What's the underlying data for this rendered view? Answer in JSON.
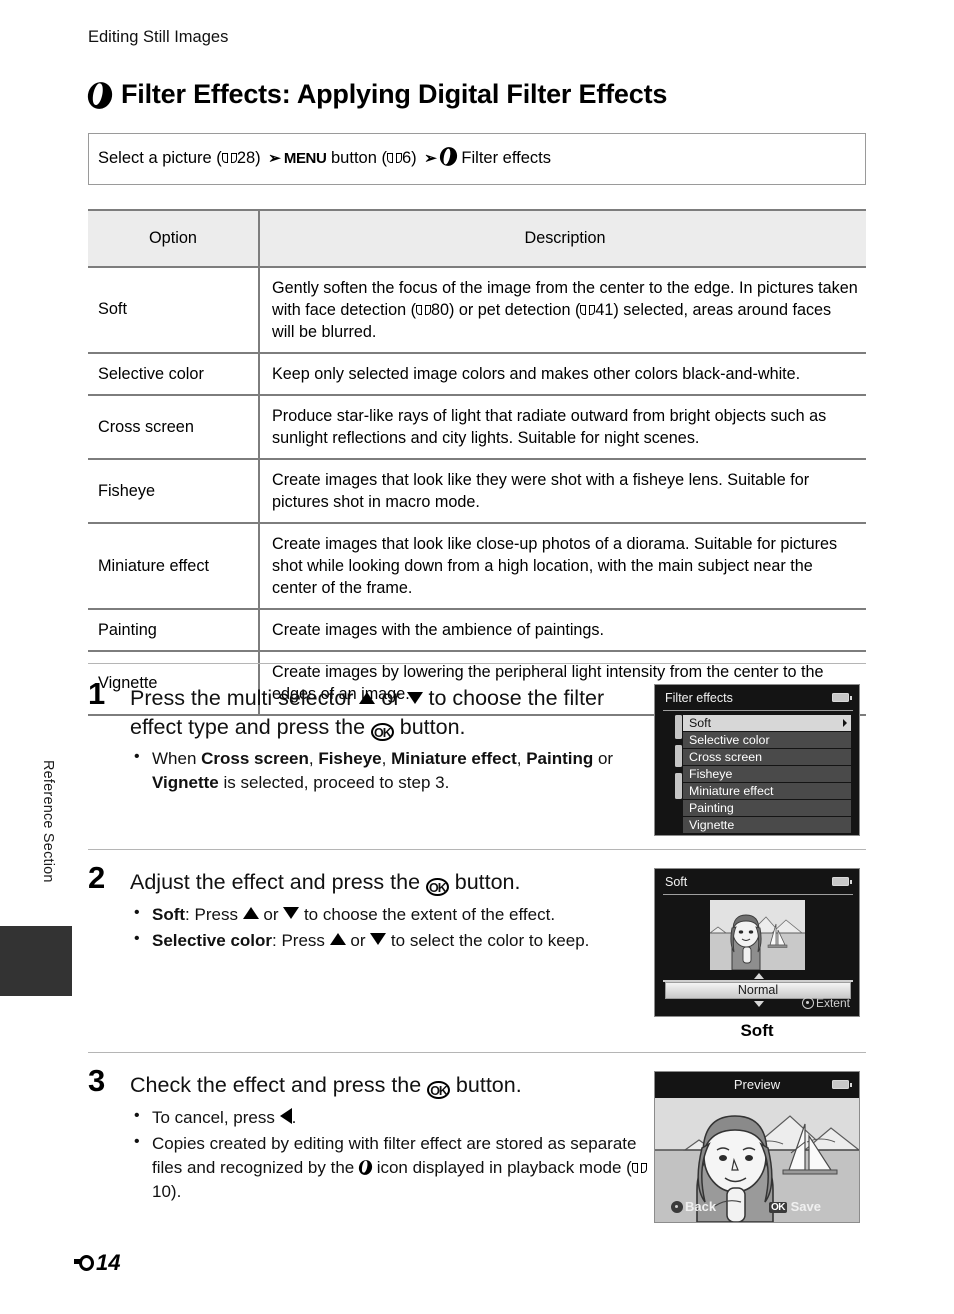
{
  "running_head": "Editing Still Images",
  "side_tab": {
    "label": "Reference Section"
  },
  "page_title": "Filter Effects: Applying Digital Filter Effects",
  "breadcrumb": {
    "part1": "Select a picture (",
    "ref1": "28",
    "part2": ") ",
    "menu_word": "MENU",
    "part3": " button (",
    "ref2": "6",
    "part4": ") ",
    "tail": "Filter effects"
  },
  "table": {
    "headers": [
      "Option",
      "Description"
    ],
    "rows": [
      {
        "option": "Soft",
        "description": "Gently soften the focus of the image from the center to the edge. In pictures taken with face detection ( 80) or pet detection ( 41) selected, areas around faces will be blurred.",
        "desc_pre": "Gently soften the focus of the image from the center to the edge. In pictures taken with face detection (",
        "desc_ref1": "80",
        "desc_mid": ") or pet detection (",
        "desc_ref2": "41",
        "desc_post": ") selected, areas around faces will be blurred."
      },
      {
        "option": "Selective color",
        "description": "Keep only selected image colors and makes other colors black-and-white."
      },
      {
        "option": "Cross screen",
        "description": "Produce star-like rays of light that radiate outward from bright objects such as sunlight reflections and city lights. Suitable for night scenes."
      },
      {
        "option": "Fisheye",
        "description": "Create images that look like they were shot with a fisheye lens. Suitable for pictures shot in macro mode."
      },
      {
        "option": "Miniature effect",
        "description": "Create images that look like close-up photos of a diorama. Suitable for pictures shot while looking down from a high location, with the main subject near the center of the frame."
      },
      {
        "option": "Painting",
        "description": "Create images with the ambience of paintings."
      },
      {
        "option": "Vignette",
        "description": "Create images by lowering the peripheral light intensity from the center to the edges of an image."
      }
    ]
  },
  "steps": [
    {
      "number": "1",
      "head_a": "Press the multi selector ",
      "head_b": " or ",
      "head_c": " to choose the filter effect type and press the ",
      "head_d": " button.",
      "bullet_pre": "When ",
      "bold1": "Cross screen",
      "sep1": ", ",
      "bold2": "Fisheye",
      "sep2": ", ",
      "bold3": "Miniature effect",
      "sep3": ", ",
      "bold4": "Painting",
      "sep4": " or ",
      "bold5": "Vignette",
      "bullet_post": " is selected, proceed to step 3."
    },
    {
      "number": "2",
      "head_a": "Adjust the effect and press the ",
      "head_d": " button.",
      "b1_bold": "Soft",
      "b1_a": ": Press ",
      "b1_b": " or ",
      "b1_c": " to choose the extent of the effect.",
      "b2_bold": "Selective color",
      "b2_a": ": Press ",
      "b2_b": " or ",
      "b2_c": " to select the color to keep."
    },
    {
      "number": "3",
      "head_a": "Check the effect and press the ",
      "head_d": " button.",
      "b1_a": "To cancel, press ",
      "b1_b": ".",
      "b2_a": "Copies created by editing with filter effect are stored as separate files and recognized by the ",
      "b2_b": " icon displayed in playback mode (",
      "b2_ref": "10",
      "b2_c": ")."
    }
  ],
  "screen1": {
    "title": "Filter effects",
    "items": [
      "Soft",
      "Selective color",
      "Cross screen",
      "Fisheye",
      "Miniature effect",
      "Painting",
      "Vignette"
    ],
    "selected_index": 0
  },
  "screen2": {
    "title": "Soft",
    "value": "Normal",
    "hint": "Extent",
    "caption": "Soft"
  },
  "screen3": {
    "title": "Preview",
    "back_label": "Back",
    "save_label": "Save",
    "ok_glyph": "OK"
  },
  "folio": {
    "page": "14"
  },
  "colors": {
    "rule": "#7d7d7d",
    "header_fill": "#ececec",
    "screen_bg": "#141414",
    "menu_row": "#4a4a4a",
    "menu_row_selected": "#d7d7d7",
    "tab_block": "#333333"
  }
}
